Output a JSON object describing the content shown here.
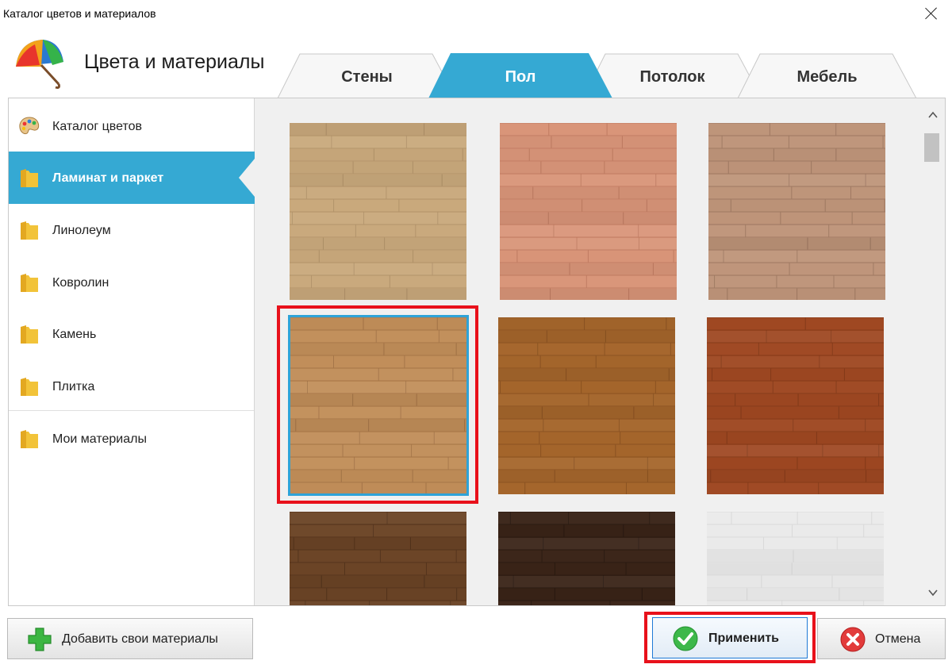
{
  "window": {
    "title": "Каталог цветов и материалов"
  },
  "header": {
    "title": "Цвета и материалы",
    "logo_icon": "umbrella-icon"
  },
  "tabs": [
    {
      "label": "Стены",
      "active": false
    },
    {
      "label": "Пол",
      "active": true
    },
    {
      "label": "Потолок",
      "active": false
    },
    {
      "label": "Мебель",
      "active": false
    }
  ],
  "sidebar": {
    "items": [
      {
        "label": "Каталог цветов",
        "icon": "palette-icon",
        "active": false
      },
      {
        "label": "Ламинат и паркет",
        "icon": "folder-icon",
        "active": true
      },
      {
        "label": "Линолеум",
        "icon": "folder-icon",
        "active": false
      },
      {
        "label": "Ковролин",
        "icon": "folder-icon",
        "active": false
      },
      {
        "label": "Камень",
        "icon": "folder-icon",
        "active": false
      },
      {
        "label": "Плитка",
        "icon": "folder-icon",
        "active": false
      },
      {
        "label": "Мои материалы",
        "icon": "folder-icon",
        "active": false
      }
    ]
  },
  "materials": [
    {
      "name": "light-oak",
      "base": "#c9a97c",
      "line": "#b2936a",
      "selected": false
    },
    {
      "name": "pink-birch",
      "base": "#d99579",
      "line": "#c07c62",
      "selected": false
    },
    {
      "name": "ash-brown",
      "base": "#be9479",
      "line": "#9f7962",
      "selected": false
    },
    {
      "name": "natural-oak",
      "base": "#c18e59",
      "line": "#a57548",
      "selected": true
    },
    {
      "name": "walnut",
      "base": "#a5662c",
      "line": "#8b5322",
      "selected": false
    },
    {
      "name": "mahogany",
      "base": "#9f4822",
      "line": "#853b1a",
      "selected": false
    },
    {
      "name": "dark-walnut",
      "base": "#6b4426",
      "line": "#54341c",
      "selected": false
    },
    {
      "name": "wenge",
      "base": "#3a2418",
      "line": "#2a1a11",
      "selected": false
    },
    {
      "name": "white-oak",
      "base": "#eaeaea",
      "line": "#d9d9d9",
      "selected": false
    }
  ],
  "buttons": {
    "add_label": "Добавить свои материалы",
    "apply_label": "Применить",
    "cancel_label": "Отмена"
  },
  "colors": {
    "accent": "#35a9d3",
    "highlight": "#e8111b",
    "selection": "#2ea3d8"
  }
}
